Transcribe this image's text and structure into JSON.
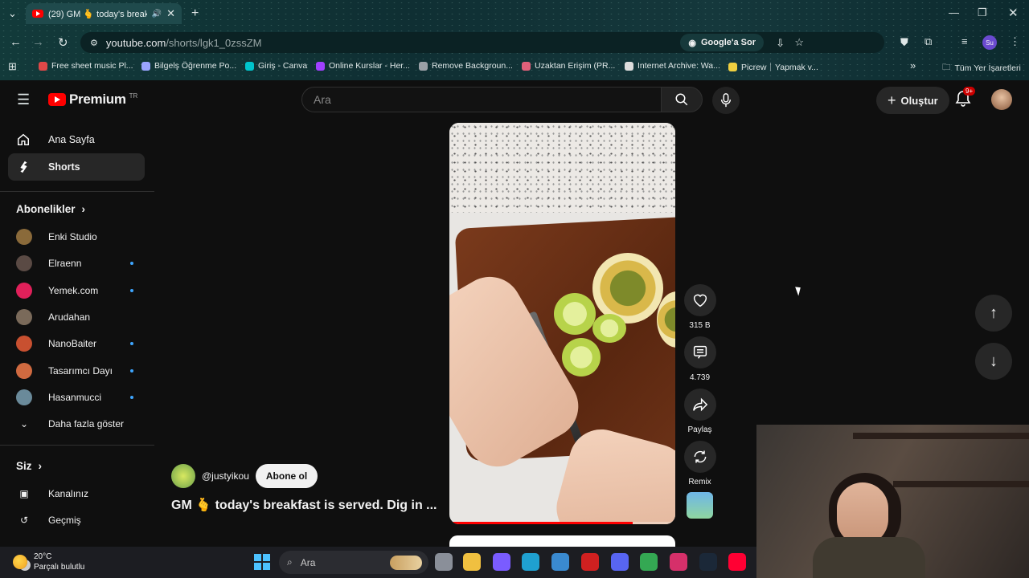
{
  "browser": {
    "tab_title": "(29) GM 🫰 today's breakfa",
    "url_host": "youtube.com",
    "url_path": "/shorts/lgk1_0zssZM",
    "google_ask": "Google'a Sor",
    "profile_initials": "Su",
    "bookmarks": [
      {
        "label": "Free sheet music Pl...",
        "color": "#e04848"
      },
      {
        "label": "Bilgelş Öğrenme Po...",
        "color": "#9aa4ff"
      },
      {
        "label": "Giriş - Canva",
        "color": "#00c4cc"
      },
      {
        "label": "Online Kurslar - Her...",
        "color": "#a040ff"
      },
      {
        "label": "Remove Backgroun...",
        "color": "#9aa0a6"
      },
      {
        "label": "Uzaktan Erişim (PR...",
        "color": "#e0607a"
      },
      {
        "label": "Internet Archive: Wa...",
        "color": "#dddddd"
      },
      {
        "label": "Picrew｜Yapmak v...",
        "color": "#f0d040"
      }
    ],
    "all_bookmarks": "Tüm Yer İşaretleri"
  },
  "header": {
    "logo_text": "Premium",
    "logo_region": "TR",
    "search_placeholder": "Ara",
    "create_label": "Oluştur",
    "notifications_badge": "9+"
  },
  "sidebar": {
    "items": [
      {
        "label": "Ana Sayfa",
        "icon": "home-icon"
      },
      {
        "label": "Shorts",
        "icon": "shorts-icon",
        "active": true
      }
    ],
    "subscriptions_title": "Abonelikler",
    "subscriptions": [
      {
        "name": "Enki Studio",
        "color": "#8a6a3a",
        "new": false
      },
      {
        "name": "Elraenn",
        "color": "#5a4a44",
        "new": true
      },
      {
        "name": "Yemek.com",
        "color": "#e0205a",
        "new": true
      },
      {
        "name": "Arudahan",
        "color": "#7a6a5a",
        "new": false
      },
      {
        "name": "NanoBaiter",
        "color": "#c85030",
        "new": true
      },
      {
        "name": "Tasarımcı Dayı",
        "color": "#d06a40",
        "new": true
      },
      {
        "name": "Hasanmucci",
        "color": "#6a8a9a",
        "new": true
      }
    ],
    "show_more": "Daha fazla göster",
    "you_title": "Siz",
    "you_items": [
      {
        "label": "Kanalınız",
        "icon": "channel-icon"
      },
      {
        "label": "Geçmiş",
        "icon": "history-icon"
      }
    ]
  },
  "short": {
    "channel": "@justyikou",
    "subscribe": "Abone ol",
    "title": "GM 🫰 today's breakfast is served. Dig in ...",
    "progress": 0.81,
    "likes": "315 B",
    "comments": "4.739",
    "share": "Paylaş",
    "remix": "Remix"
  },
  "taskbar": {
    "temp": "20°C",
    "weather": "Parçalı bulutlu",
    "search": "Ara",
    "apps": [
      {
        "name": "file-explorer-icon",
        "color": "#f0c040"
      },
      {
        "name": "copilot-icon",
        "color": "#7a5cff"
      },
      {
        "name": "edge-icon",
        "color": "#1fa0d0"
      },
      {
        "name": "store-icon",
        "color": "#3a8ad0"
      },
      {
        "name": "l-app-icon",
        "color": "#d02020"
      },
      {
        "name": "discord-icon",
        "color": "#5865f2"
      },
      {
        "name": "chrome-icon",
        "color": "#34a853"
      },
      {
        "name": "instagram-icon",
        "color": "#d6306a"
      },
      {
        "name": "steam-icon",
        "color": "#1b2838"
      },
      {
        "name": "youtube-music-icon",
        "color": "#ff0033"
      }
    ]
  }
}
